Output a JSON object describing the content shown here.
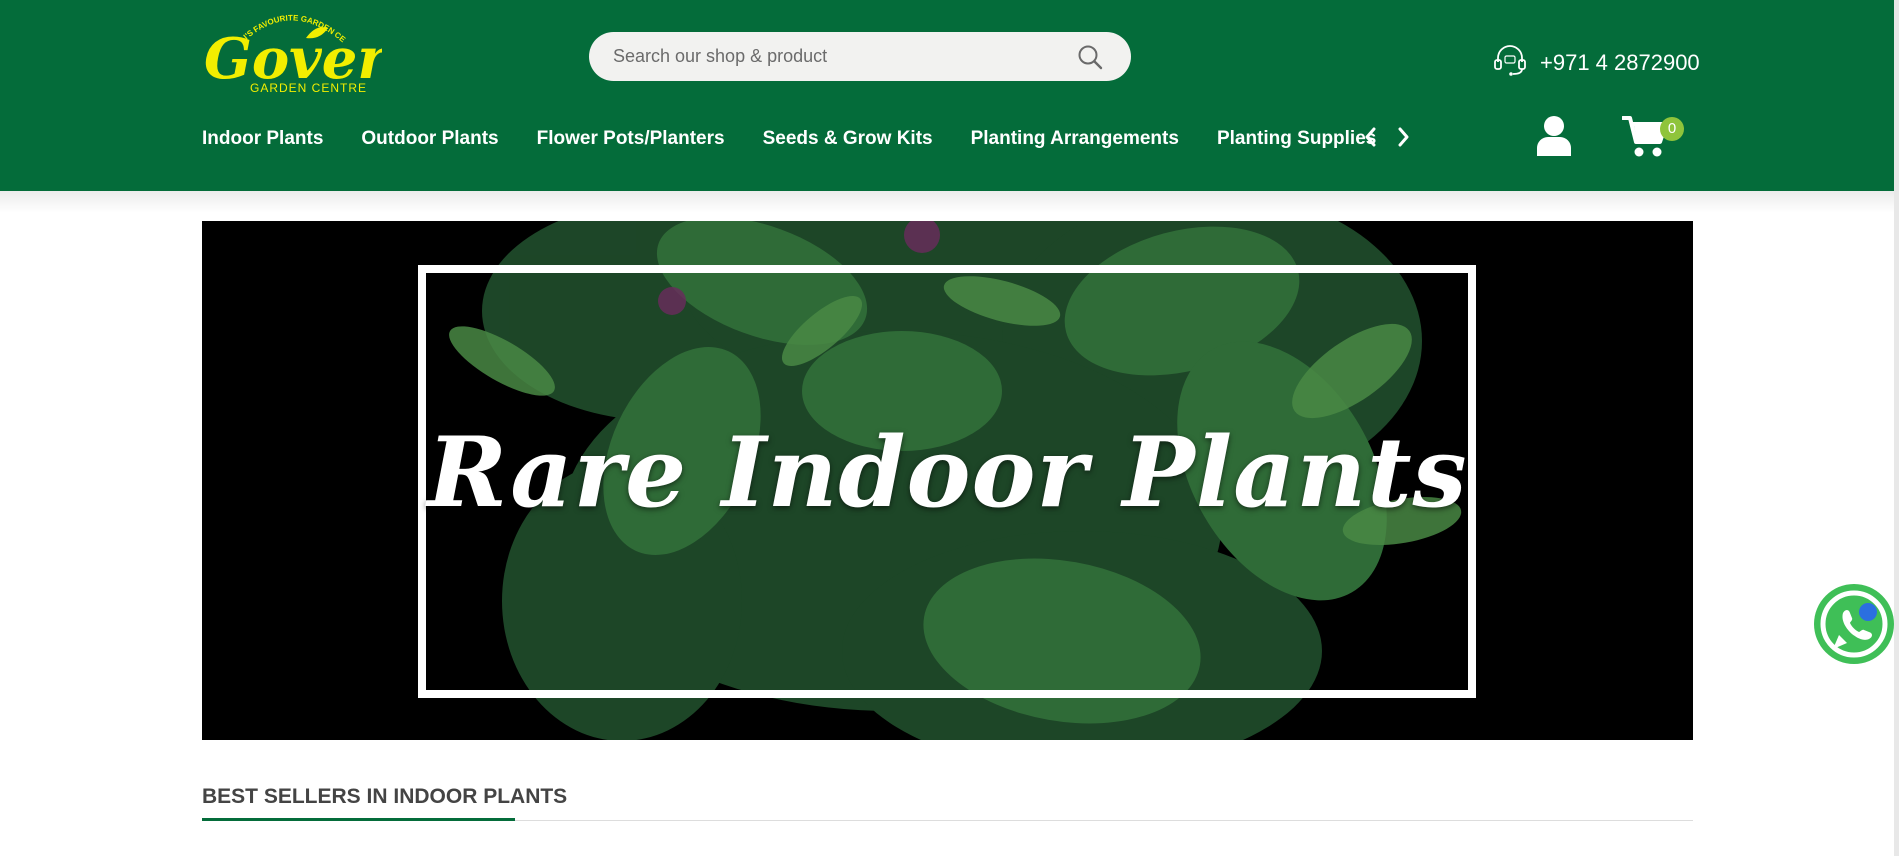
{
  "brand": {
    "name": "Gover",
    "tagline": "DUBAI'S FAVOURITE GARDEN CENTRE",
    "subtitle": "GARDEN CENTRE",
    "color_primary": "#046c3a",
    "color_logo": "#f2ee00",
    "color_badge": "#8fc43b"
  },
  "search": {
    "placeholder": "Search our shop & product",
    "icon": "search-icon"
  },
  "contact": {
    "phone": "+971 4 2872900",
    "icon": "headset-icon"
  },
  "nav": {
    "items": [
      {
        "label": "Indoor Plants"
      },
      {
        "label": "Outdoor Plants"
      },
      {
        "label": "Flower Pots/Planters"
      },
      {
        "label": "Seeds & Grow Kits"
      },
      {
        "label": "Planting Arrangements"
      },
      {
        "label": "Planting Supplies"
      }
    ],
    "prev_icon": "chevron-left-icon",
    "next_icon": "chevron-right-icon"
  },
  "account": {
    "icon": "user-icon"
  },
  "cart": {
    "icon": "cart-icon",
    "count": "0"
  },
  "banner": {
    "title": "Rare Indoor Plants"
  },
  "section": {
    "title": "BEST SELLERS IN INDOOR PLANTS"
  },
  "chat": {
    "icon": "whatsapp-icon"
  }
}
